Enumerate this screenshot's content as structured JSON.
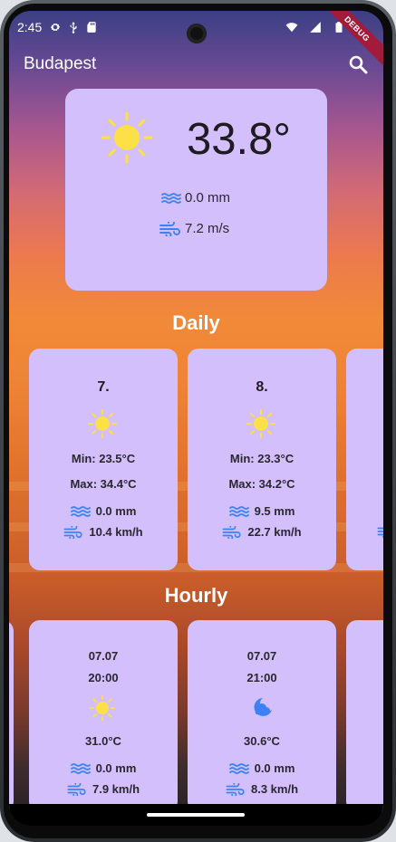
{
  "status_bar": {
    "time": "2:45",
    "icons": [
      "gear-icon",
      "usb-icon",
      "sd-card-icon",
      "wifi-icon",
      "cellular-icon",
      "battery-icon"
    ]
  },
  "debug_banner": "DEBUG",
  "app_bar": {
    "city": "Budapest",
    "search_icon": "search-icon"
  },
  "current": {
    "icon": "sun-icon",
    "temperature": "33.8°",
    "precipitation": "0.0 mm",
    "wind": "7.2 m/s"
  },
  "daily": {
    "title": "Daily",
    "items": [
      {
        "day": "7.",
        "icon": "sun-icon",
        "min": "Min: 23.5°C",
        "max": "Max:  34.4°C",
        "precipitation": "0.0 mm",
        "wind": "10.4 km/h"
      },
      {
        "day": "8.",
        "icon": "sun-icon",
        "min": "Min: 23.3°C",
        "max": "Max:  34.2°C",
        "precipitation": "9.5 mm",
        "wind": "22.7 km/h"
      }
    ]
  },
  "hourly": {
    "title": "Hourly",
    "items": [
      {
        "date": "07.07",
        "time": "20:00",
        "icon": "sun-icon",
        "temperature": "31.0°C",
        "precipitation": "0.0 mm",
        "wind": "7.9 km/h"
      },
      {
        "date": "07.07",
        "time": "21:00",
        "icon": "moon-cloud-icon",
        "temperature": "30.6°C",
        "precipitation": "0.0 mm",
        "wind": "8.3 km/h"
      }
    ]
  },
  "colors": {
    "card": "#d2bffc",
    "sun": "#fde047",
    "accent_blue": "#3b82f6",
    "debug": "#a31b3b"
  }
}
